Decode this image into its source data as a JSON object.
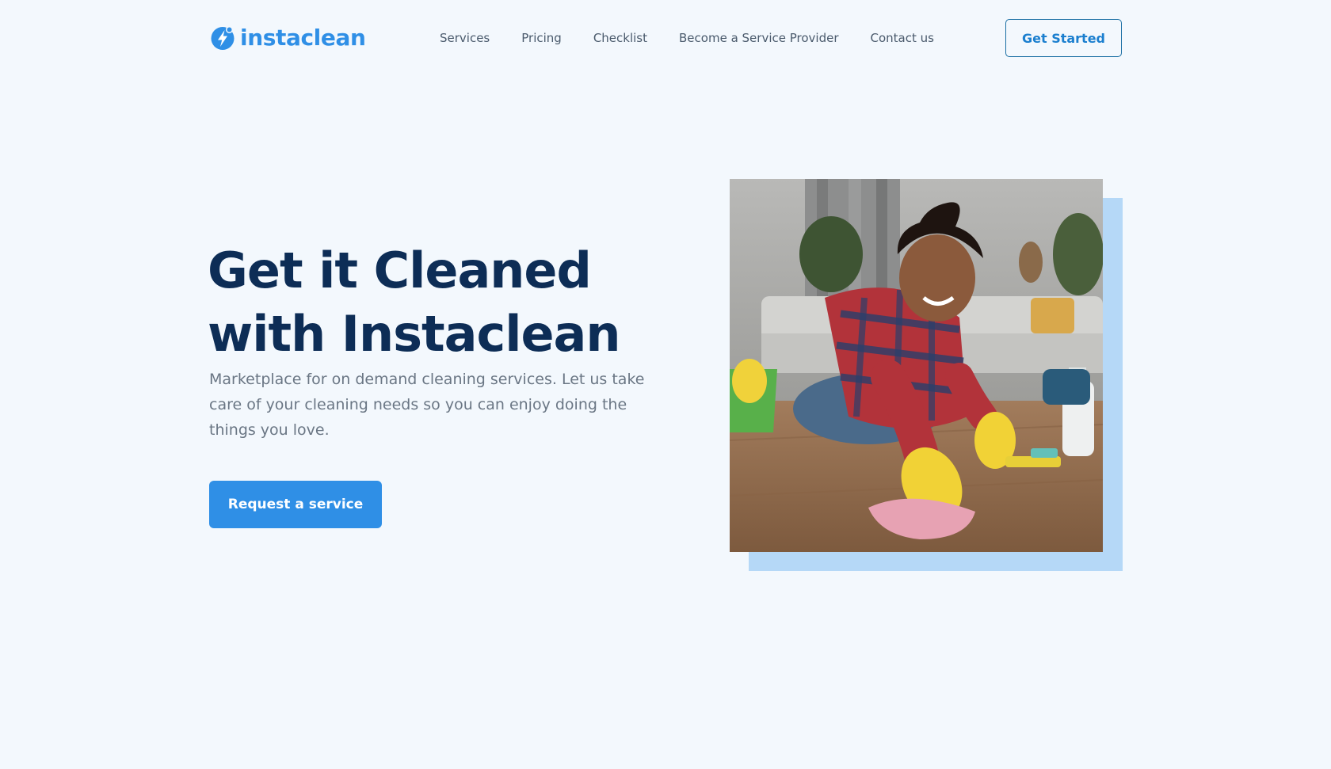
{
  "brand": {
    "name": "instaclean",
    "accent_color": "#2f8fe6",
    "logo_icon": "lightning-bolt-icon"
  },
  "nav": {
    "items": [
      {
        "label": "Services"
      },
      {
        "label": "Pricing"
      },
      {
        "label": "Checklist"
      },
      {
        "label": "Become a Service Provider"
      },
      {
        "label": "Contact us"
      }
    ],
    "cta_label": "Get Started"
  },
  "hero": {
    "title_line1": "Get it Cleaned",
    "title_line2": "with Instaclean",
    "subtitle": "Marketplace for on demand cleaning services. Let us take care of your cleaning needs so you can enjoy doing the things you love.",
    "cta_label": "Request a service",
    "image_alt": "Smiling woman in yellow gloves cleaning a wooden floor with a pink cloth",
    "heading_color": "#0d2d56",
    "shadow_color": "#b5d8f7"
  }
}
